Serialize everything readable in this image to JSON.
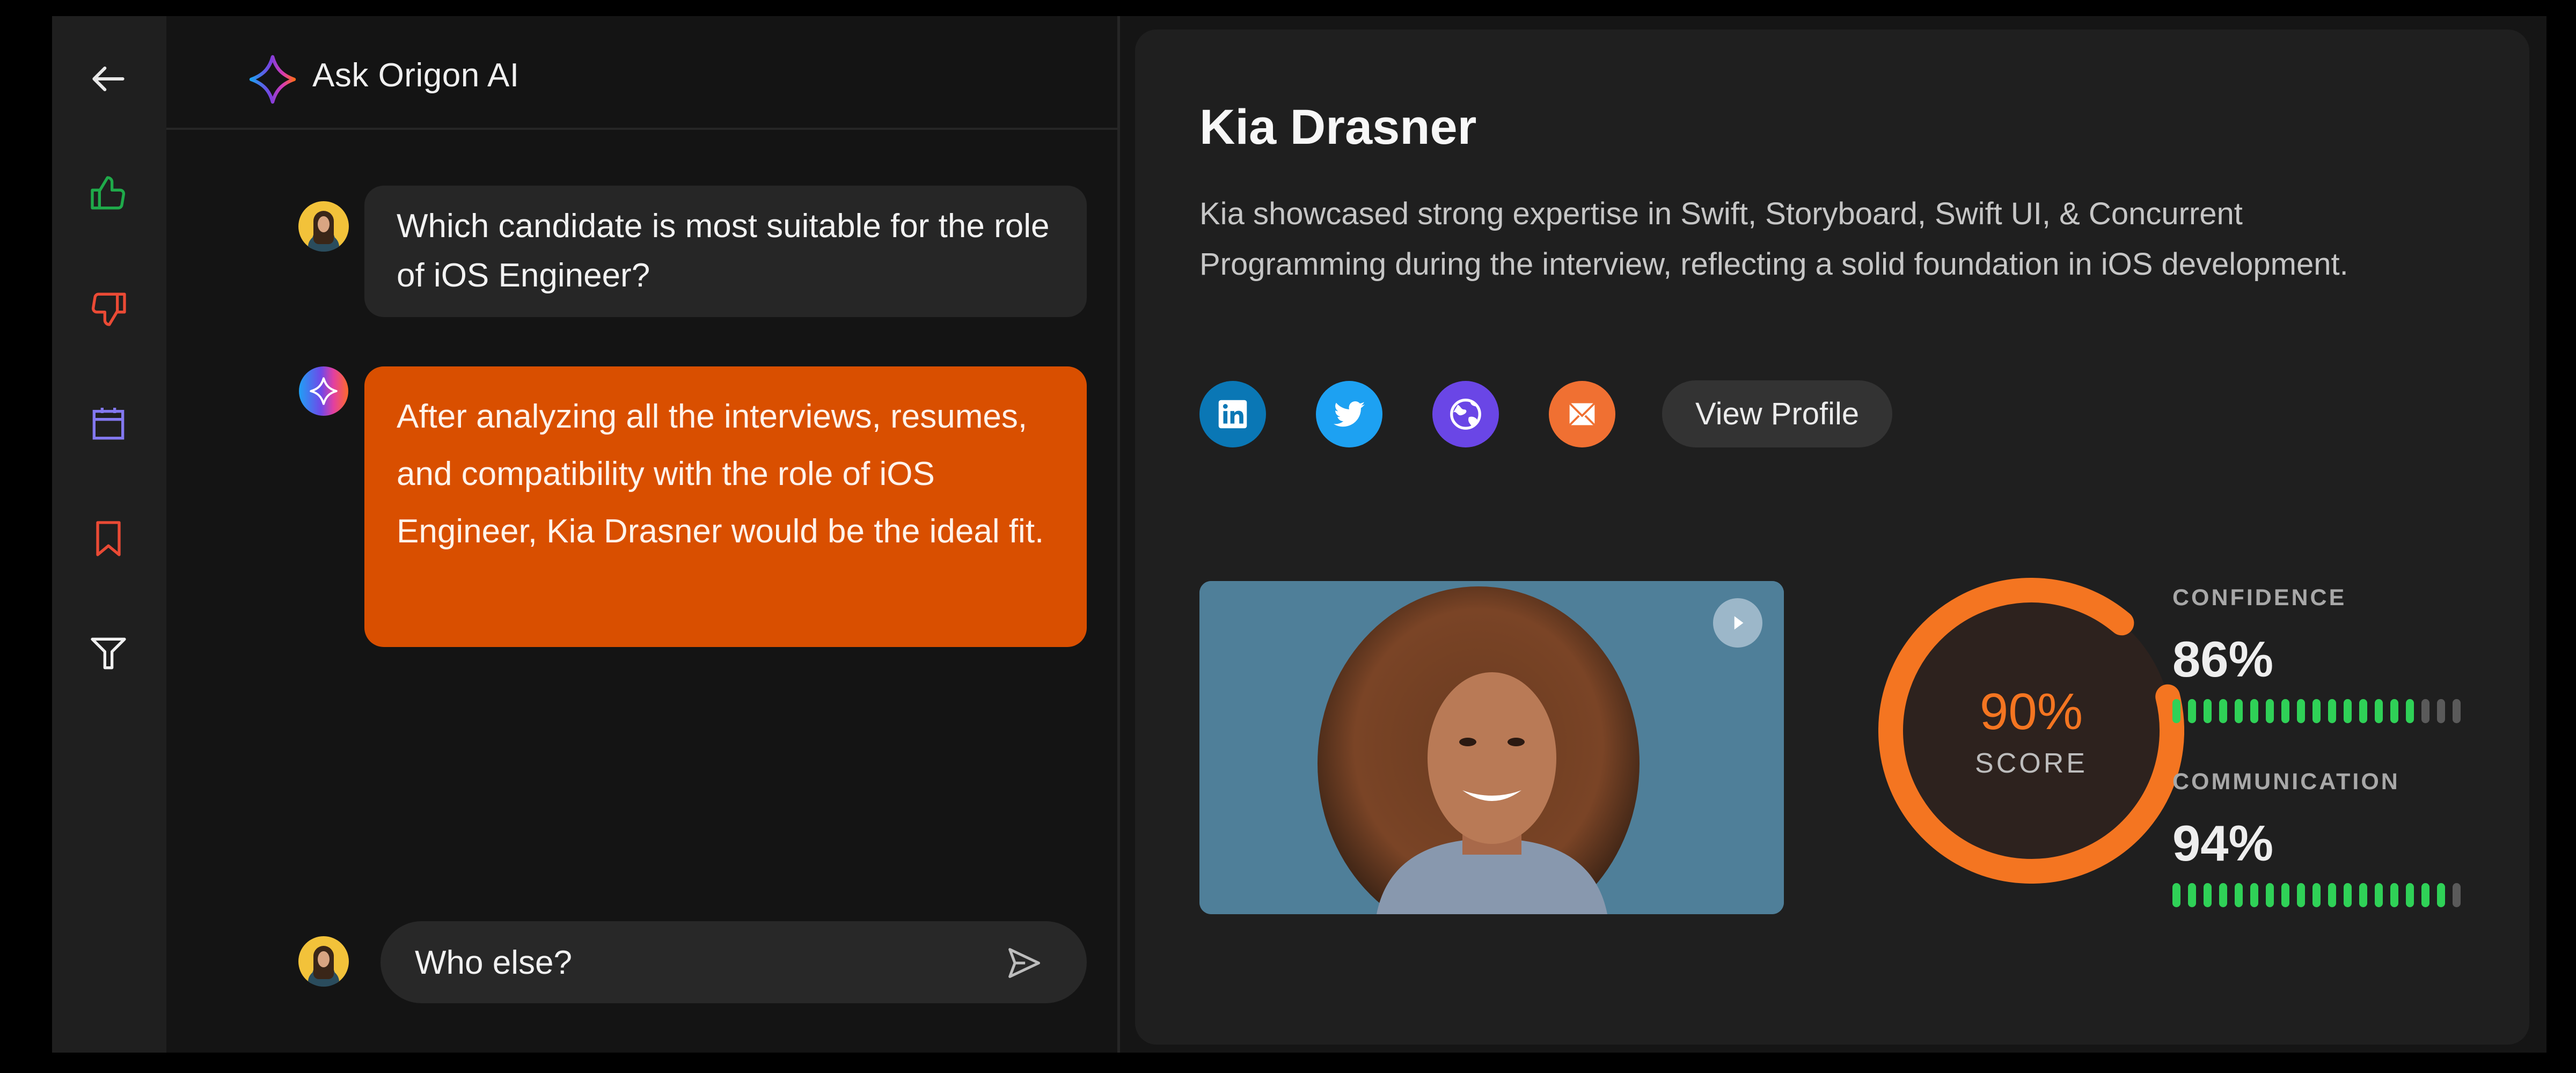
{
  "sidebar": {
    "items": [
      {
        "name": "back",
        "icon": "arrow-left-icon",
        "color": "#e8e8e8"
      },
      {
        "name": "like",
        "icon": "thumbs-up-icon",
        "color": "#1faa4a"
      },
      {
        "name": "dislike",
        "icon": "thumbs-down-icon",
        "color": "#ea4a35"
      },
      {
        "name": "calendar",
        "icon": "calendar-icon",
        "color": "#8378f0"
      },
      {
        "name": "bookmark",
        "icon": "bookmark-icon",
        "color": "#ea4a35"
      },
      {
        "name": "filter",
        "icon": "filter-icon",
        "color": "#f0f0f0"
      }
    ]
  },
  "chat": {
    "title": "Ask Origon AI",
    "messages": [
      {
        "role": "user",
        "text": "Which candidate is most suitable for the role of iOS Engineer?"
      },
      {
        "role": "assistant",
        "text": "After analyzing all the interviews, resumes, and compatibility with the role of  iOS Engineer, Kia Drasner would be the ideal fit."
      }
    ],
    "composer": {
      "value": "Who else?",
      "placeholder": ""
    }
  },
  "candidate": {
    "name": "Kia Drasner",
    "description": "Kia showcased strong expertise in Swift, Storyboard, Swift UI, & Concurrent Programming during the interview, reflecting a solid foundation in iOS development.",
    "socials": [
      {
        "name": "linkedin",
        "icon": "linkedin-icon",
        "color": "#0a77b5"
      },
      {
        "name": "twitter",
        "icon": "twitter-icon",
        "color": "#1da1f2"
      },
      {
        "name": "website",
        "icon": "globe-icon",
        "color": "#6a46e6"
      },
      {
        "name": "email",
        "icon": "mail-icon",
        "color": "#f07032"
      }
    ],
    "view_profile_label": "View Profile",
    "video": {
      "play_icon": "play-icon"
    },
    "score": {
      "value": 90,
      "display": "90%",
      "label": "SCORE",
      "color": "#f47521"
    },
    "metrics": [
      {
        "label": "CONFIDENCE",
        "value": 86,
        "display": "86%",
        "ticks_total": 19,
        "ticks_filled": 16
      },
      {
        "label": "COMMUNICATION",
        "value": 94,
        "display": "94%",
        "ticks_total": 19,
        "ticks_filled": 18
      }
    ],
    "tick_colors": {
      "filled": "#2fd157",
      "empty": "#5a5a5a"
    }
  }
}
